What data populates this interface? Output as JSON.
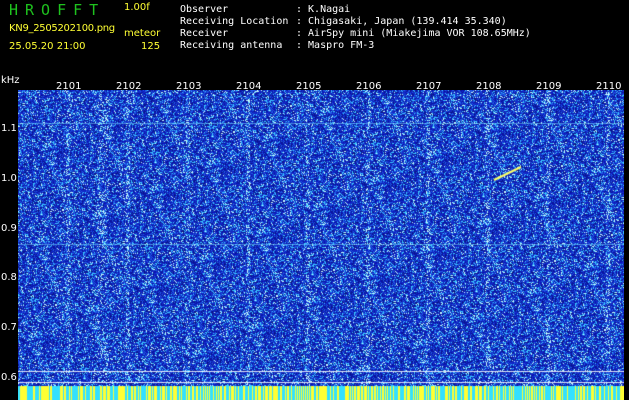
{
  "header": {
    "app_title": "HROFFT",
    "version": "1.00f",
    "filename": "KN9_2505202100.png",
    "mode": "meteor",
    "datetime": "25.05.20 21:00",
    "count": "125"
  },
  "info": [
    {
      "label": "Observer",
      "value": ": K.Nagai"
    },
    {
      "label": "Receiving Location",
      "value": ": Chigasaki, Japan (139.414 35.340)"
    },
    {
      "label": "Receiver",
      "value": ": AirSpy mini (Miakejima VOR 108.65MHz)"
    },
    {
      "label": "Receiving antenna",
      "value": ": Maspro FM-3"
    }
  ],
  "axis": {
    "unit": "kHz",
    "y_ticks": [
      "1.1",
      "1.0",
      "0.9",
      "0.8",
      "0.7",
      "0.6"
    ],
    "x_ticks": [
      "2101",
      "2102",
      "2103",
      "2104",
      "2105",
      "2106",
      "2107",
      "2108",
      "2109",
      "2110"
    ]
  },
  "colors": {
    "background": "#000000",
    "label_green": "#1ec21e",
    "label_yellow": "#ffff33",
    "noise_blue": "#1e2fd0",
    "noise_cyan": "#4fe6ff"
  }
}
